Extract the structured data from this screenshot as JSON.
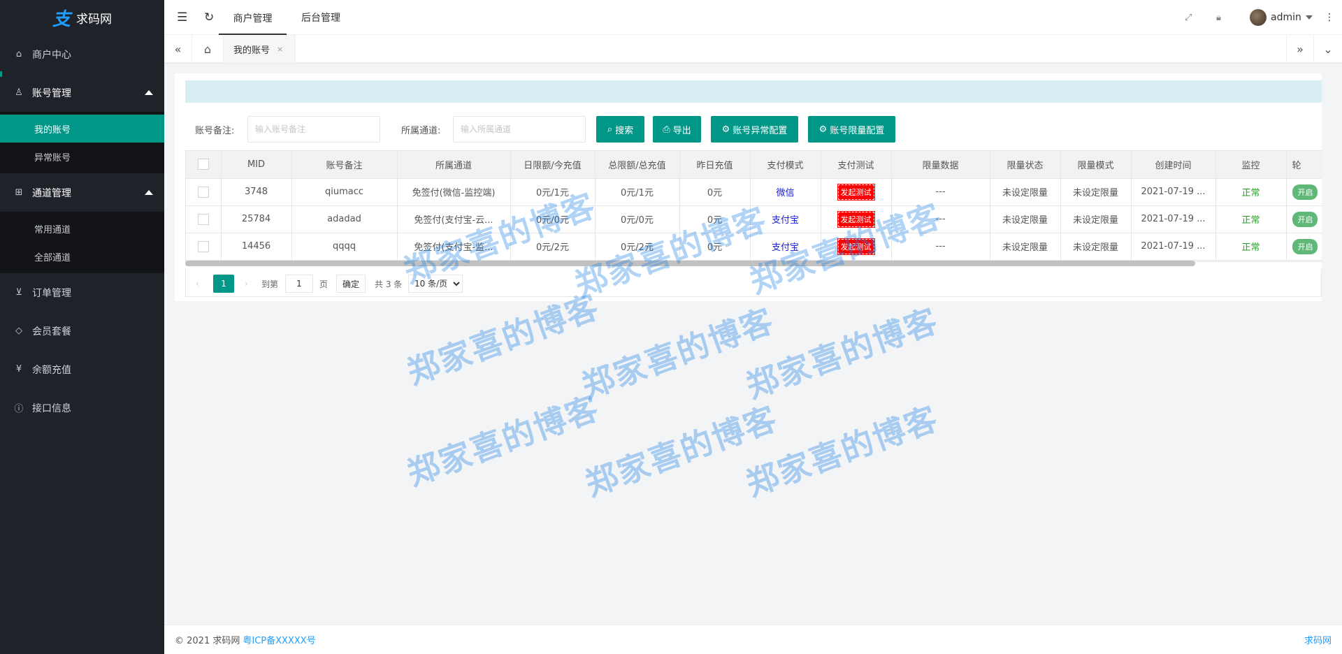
{
  "app": {
    "logo_text": "求码网"
  },
  "sidebar": {
    "items": [
      {
        "label": "商户中心",
        "icon": "home-icon"
      },
      {
        "label": "账号管理",
        "icon": "user-icon",
        "children": [
          "我的账号",
          "异常账号"
        ]
      },
      {
        "label": "通道管理",
        "icon": "channel-icon",
        "children": [
          "常用通道",
          "全部通道"
        ]
      },
      {
        "label": "订单管理",
        "icon": "cart-icon"
      },
      {
        "label": "会员套餐",
        "icon": "diamond-icon"
      },
      {
        "label": "余额充值",
        "icon": "yen-icon"
      },
      {
        "label": "接口信息",
        "icon": "info-icon"
      }
    ],
    "active_child": "我的账号"
  },
  "header": {
    "tabs": [
      "商户管理",
      "后台管理"
    ],
    "active_tab": "商户管理",
    "user": "admin"
  },
  "tabbar": {
    "current_tab": "我的账号",
    "close_glyph": "×"
  },
  "search": {
    "remark_label": "账号备注:",
    "remark_placeholder": "输入账号备注",
    "channel_label": "所属通道:",
    "channel_placeholder": "输入所属通道",
    "buttons": {
      "search": "搜索",
      "export": "导出",
      "abnormal_config": "账号异常配置",
      "limit_config": "账号限量配置"
    }
  },
  "table": {
    "columns": [
      "MID",
      "账号备注",
      "所属通道",
      "日限额/今充值",
      "总限额/总充值",
      "昨日充值",
      "支付模式",
      "支付测试",
      "限量数据",
      "限量状态",
      "限量模式",
      "创建时间",
      "监控",
      "轮"
    ],
    "rows": [
      {
        "mid": "3748",
        "remark": "qiumacc",
        "channel": "免签付(微信-监控端)",
        "daily": "0元/1元",
        "total": "0元/1元",
        "yesterday": "0元",
        "pay_mode": "微信",
        "test": "发起测试",
        "limit_data": "---",
        "limit_status": "未设定限量",
        "limit_mode": "未设定限量",
        "created": "2021-07-19 ...",
        "monitor": "正常",
        "rotate": "开启"
      },
      {
        "mid": "25784",
        "remark": "adadad",
        "channel": "免签付(支付宝-云...",
        "daily": "0元/0元",
        "total": "0元/0元",
        "yesterday": "0元",
        "pay_mode": "支付宝",
        "test": "发起测试",
        "limit_data": "---",
        "limit_status": "未设定限量",
        "limit_mode": "未设定限量",
        "created": "2021-07-19 ...",
        "monitor": "正常",
        "rotate": "开启"
      },
      {
        "mid": "14456",
        "remark": "qqqq",
        "channel": "免签付(支付宝-监...",
        "daily": "0元/2元",
        "total": "0元/2元",
        "yesterday": "0元",
        "pay_mode": "支付宝",
        "test": "发起测试",
        "limit_data": "---",
        "limit_status": "未设定限量",
        "limit_mode": "未设定限量",
        "created": "2021-07-19 ...",
        "monitor": "正常",
        "rotate": "开启"
      }
    ]
  },
  "pagination": {
    "current_page": "1",
    "goto_label": "到第",
    "goto_value": "1",
    "page_unit": "页",
    "confirm": "确定",
    "total": "共 3 条",
    "page_size": "10 条/页"
  },
  "footer": {
    "copyright": "© 2021 求码网",
    "icp": "粤ICP备XXXXX号",
    "brand": "求码网"
  },
  "watermark": "郑家喜的博客",
  "colors": {
    "accent": "#009688",
    "sidebar_bg": "#20222a",
    "link": "#1e9fff",
    "danger": "#ff0000",
    "success": "#22a322"
  }
}
